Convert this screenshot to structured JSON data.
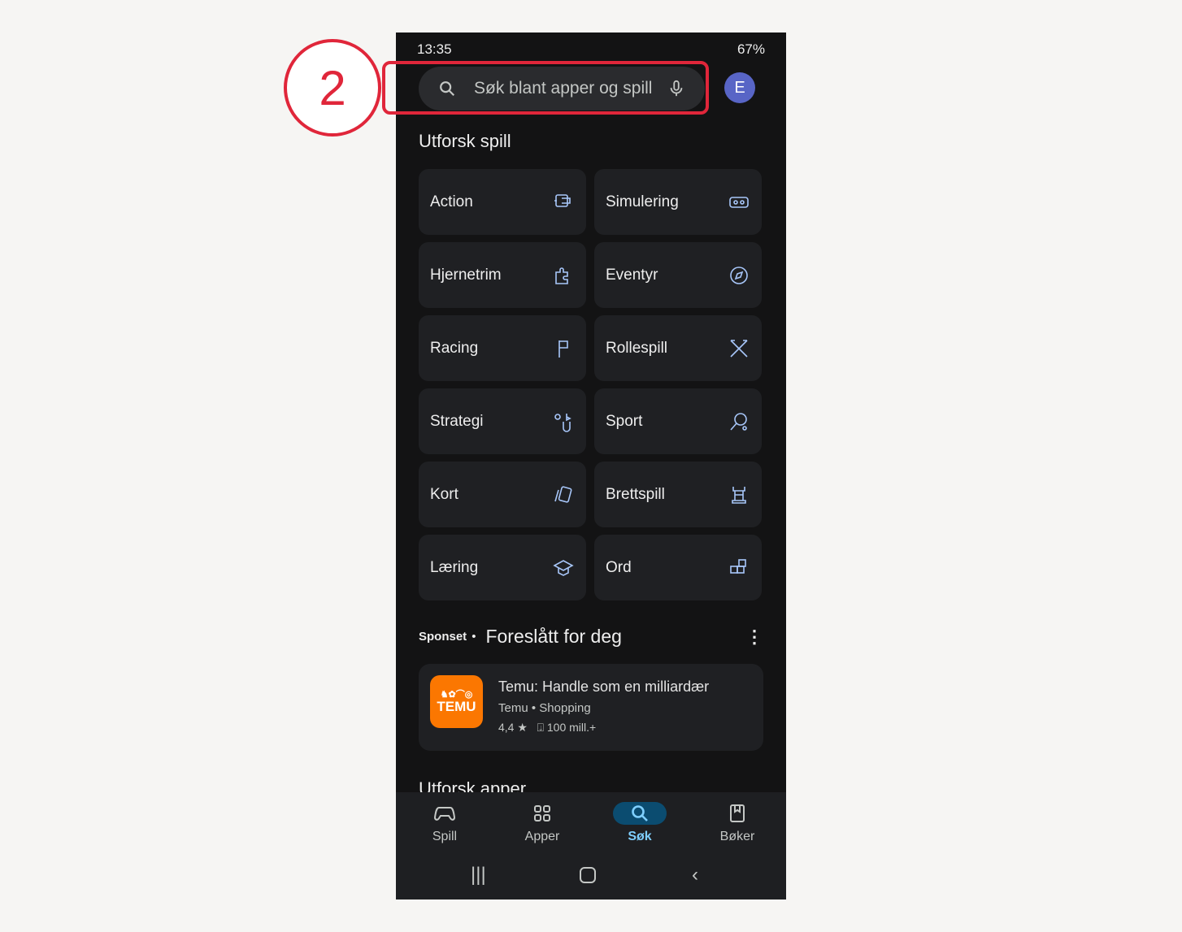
{
  "status_bar": {
    "time": "13:35",
    "battery": "67%"
  },
  "search": {
    "placeholder": "Søk blant apper og spill"
  },
  "avatar": {
    "initial": "E",
    "color": "#5865c6"
  },
  "explore_games": {
    "title": "Utforsk spill",
    "categories": [
      {
        "label": "Action",
        "icon": "action-icon"
      },
      {
        "label": "Simulering",
        "icon": "vr-headset-icon"
      },
      {
        "label": "Hjernetrim",
        "icon": "puzzle-icon"
      },
      {
        "label": "Eventyr",
        "icon": "compass-icon"
      },
      {
        "label": "Racing",
        "icon": "checkered-flag-icon"
      },
      {
        "label": "Rollespill",
        "icon": "crossed-swords-icon"
      },
      {
        "label": "Strategi",
        "icon": "strategy-icon"
      },
      {
        "label": "Sport",
        "icon": "racket-icon"
      },
      {
        "label": "Kort",
        "icon": "cards-icon"
      },
      {
        "label": "Brettspill",
        "icon": "chess-rook-icon"
      },
      {
        "label": "Læring",
        "icon": "graduation-cap-icon"
      },
      {
        "label": "Ord",
        "icon": "word-blocks-icon"
      }
    ]
  },
  "sponsored": {
    "tag": "Sponset",
    "separator": "•",
    "title": "Foreslått for deg",
    "app": {
      "name": "Temu: Handle som en milliardær",
      "developer": "Temu",
      "category": "Shopping",
      "rating": "4,4",
      "downloads": "100 mill.+",
      "logo_text": "TEMU"
    }
  },
  "next_section": "Utforsk apper",
  "bottom_nav": {
    "items": [
      {
        "label": "Spill"
      },
      {
        "label": "Apper"
      },
      {
        "label": "Søk",
        "active": true
      },
      {
        "label": "Bøker"
      }
    ]
  },
  "annotation": {
    "step": "2",
    "color": "#e0263a"
  }
}
